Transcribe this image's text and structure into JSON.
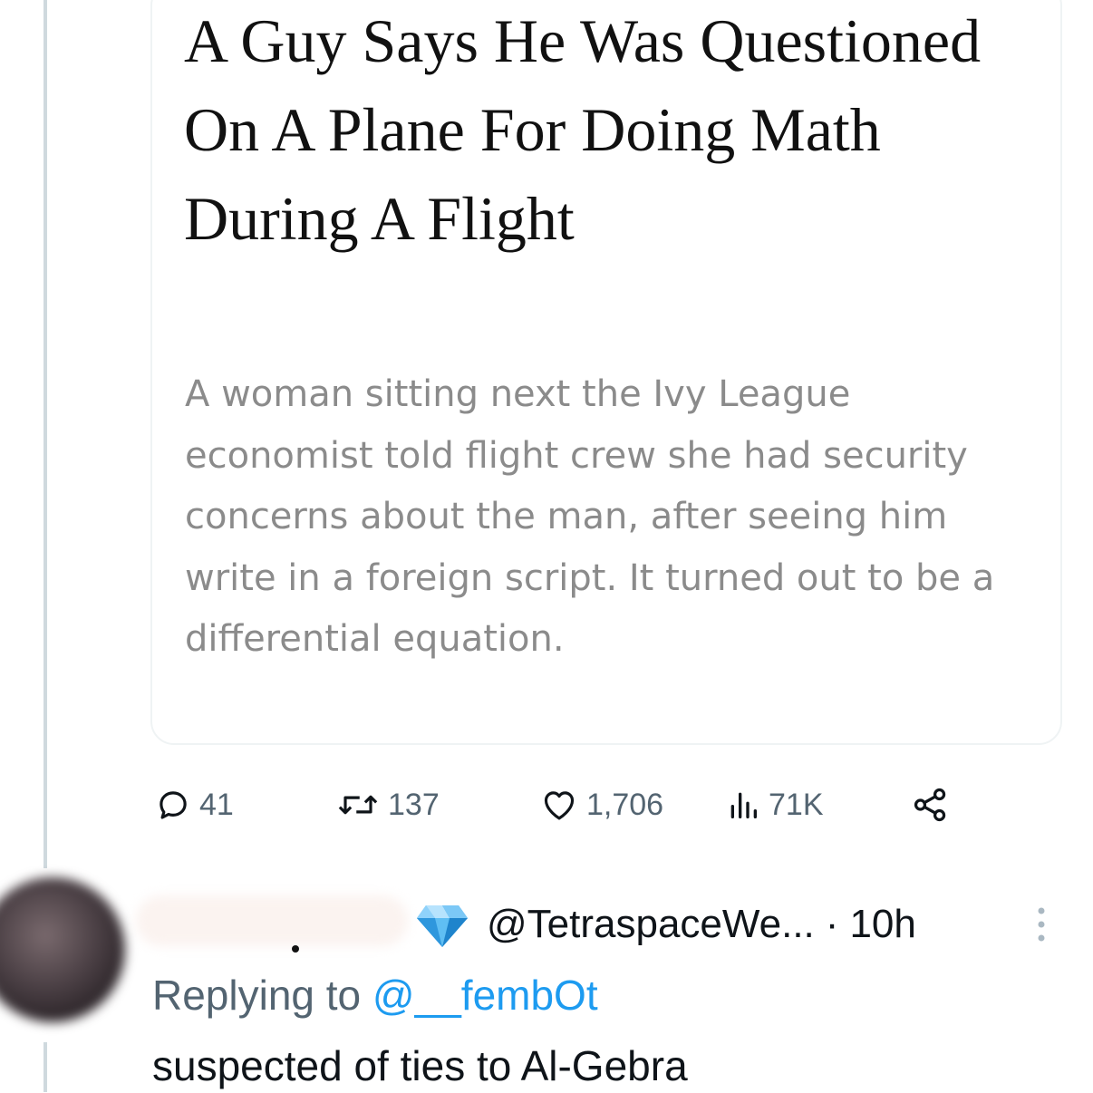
{
  "article": {
    "headline": "A Guy Says He Was Questioned On A Plane For Doing Math During A Flight",
    "subheadline": "A woman sitting next the Ivy League economist told flight crew she had security concerns about the man, after seeing him write in a foreign script. It turned out to be a differential equation."
  },
  "actions": {
    "reply_count": "41",
    "retweet_count": "137",
    "like_count": "1,706",
    "views_count": "71K",
    "icons": [
      "reply-icon",
      "retweet-icon",
      "like-icon",
      "views-icon",
      "share-icon"
    ]
  },
  "reply": {
    "handle": "@TetraspaceWe...",
    "separator": "·",
    "time": "10h",
    "replying_prefix": "Replying to",
    "replying_to": "@__fembOt",
    "text": "suspected of ties to Al-Gebra",
    "verified_icon": "diamond-verified-icon"
  },
  "colors": {
    "text": "#0f1419",
    "muted": "#536471",
    "link": "#1d9bf0",
    "thread_line": "#cfd9de"
  }
}
